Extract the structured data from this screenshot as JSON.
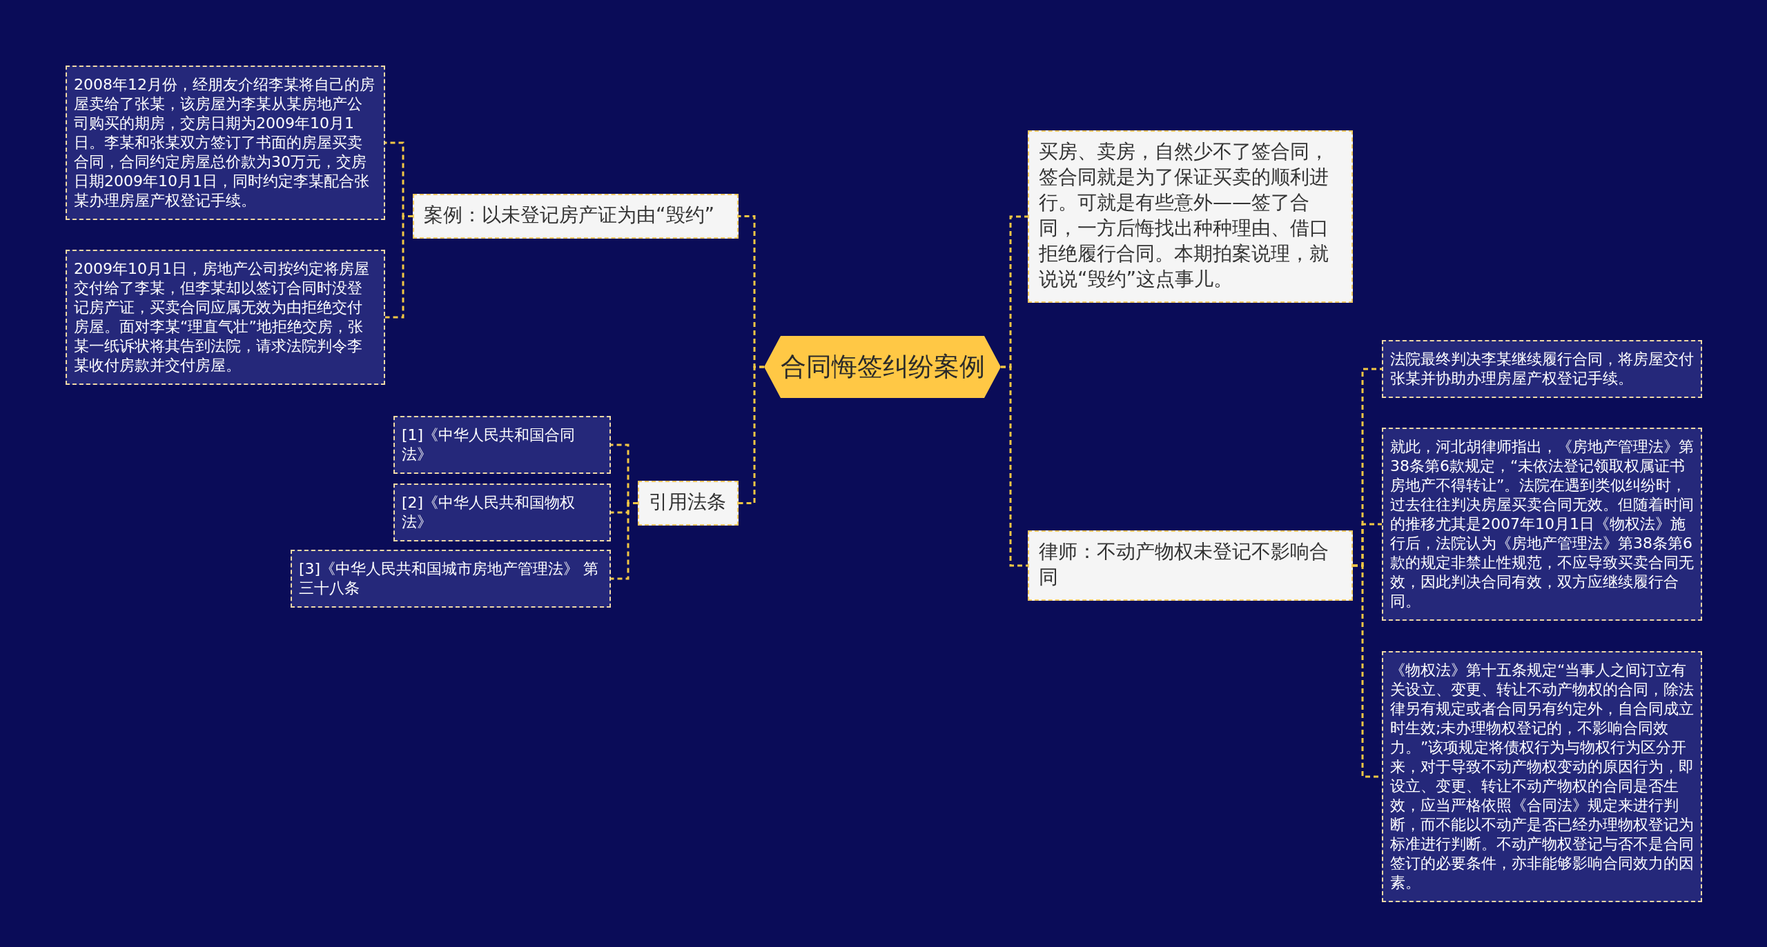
{
  "mind_map": {
    "root": {
      "text": "合同悔签纠纷案例"
    },
    "left_branches": [
      {
        "text": "案例：以未登记房产证为由“毁约”",
        "children": [
          {
            "text": "2008年12月份，经朋友介绍李某将自己的房屋卖给了张某，该房屋为李某从某房地产公司购买的期房，交房日期为2009年10月1日。李某和张某双方签订了书面的房屋买卖合同，合同约定房屋总价款为30万元，交房日期2009年10月1日，同时约定李某配合张某办理房屋产权登记手续。"
          },
          {
            "text": "2009年10月1日，房地产公司按约定将房屋交付给了李某，但李某却以签订合同时没登记房产证，买卖合同应属无效为由拒绝交付房屋。面对李某“理直气壮”地拒绝交房，张某一纸诉状将其告到法院，请求法院判令李某收付房款并交付房屋。"
          }
        ]
      },
      {
        "text": "引用法条",
        "children": [
          {
            "text": "[1]《中华人民共和国合同法》"
          },
          {
            "text": "[2]《中华人民共和国物权法》"
          },
          {
            "text": "[3]《中华人民共和国城市房地产管理法》 第三十八条"
          }
        ]
      }
    ],
    "right_branches": [
      {
        "text": "买房、卖房，自然少不了签合同，签合同就是为了保证买卖的顺利进行。可就是有些意外——签了合同，一方后悔找出种种理由、借口拒绝履行合同。本期拍案说理，就说说“毁约”这点事儿。"
      },
      {
        "text": "律师：不动产物权未登记不影响合同",
        "children": [
          {
            "text": "法院最终判决李某继续履行合同，将房屋交付张某并协助办理房屋产权登记手续。"
          },
          {
            "text": "就此，河北胡律师指出，《房地产管理法》第38条第6款规定，“未依法登记领取权属证书房地产不得转让”。法院在遇到类似纠纷时，过去往往判决房屋买卖合同无效。但随着时间的推移尤其是2007年10月1日《物权法》施行后，法院认为《房地产管理法》第38条第6款的规定非禁止性规范，不应导致买卖合同无效，因此判决合同有效，双方应继续履行合同。"
          },
          {
            "text": "《物权法》第十五条规定“当事人之间订立有关设立、变更、转让不动产物权的合同，除法律另有规定或者合同另有约定外，自合同成立时生效;未办理物权登记的，不影响合同效力。”该项规定将债权行为与物权行为区分开来，对于导致不动产物权变动的原因行为，即设立、变更、转让不动产物权的合同是否生效，应当严格依照《合同法》规定来进行判断，而不能以不动产是否已经办理物权登记为标准进行判断。不动产物权登记与否不是合同签订的必要条件，亦非能够影响合同效力的因素。"
          }
        ]
      }
    ]
  }
}
